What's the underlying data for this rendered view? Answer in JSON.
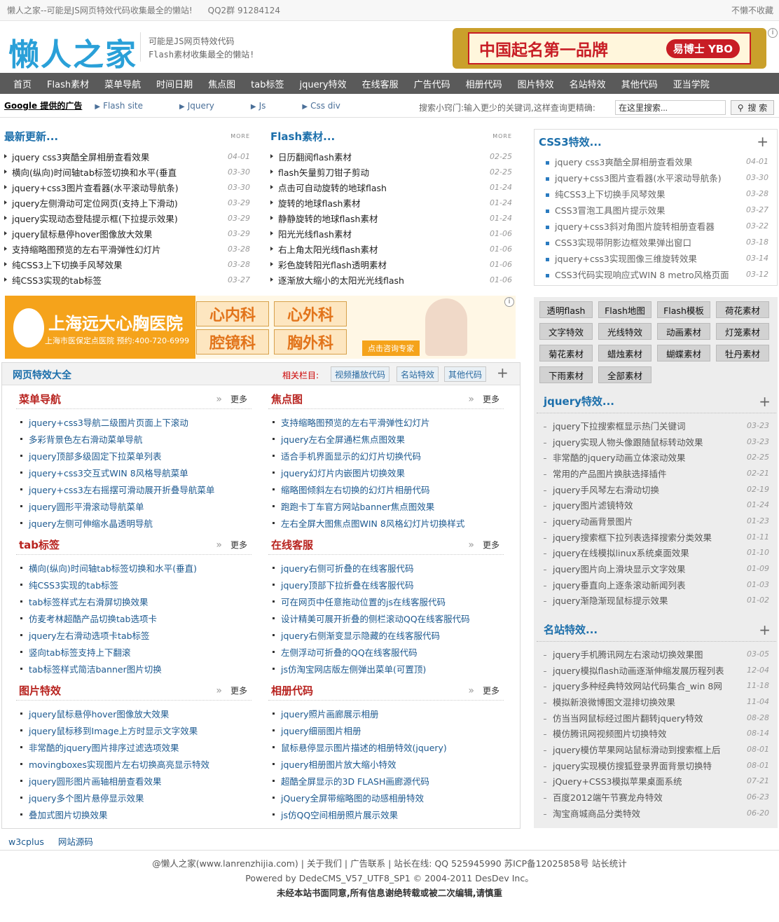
{
  "topbar": {
    "site": "懒人之家--可能是JS网页特效代码收集最全的懒站!",
    "qq": "QQ2群 91284124",
    "right": "不懒不收藏"
  },
  "header": {
    "logo": "懒人之家",
    "slogan1": "可能是JS网页特效代码",
    "slogan2": "Flash素材收集最全的懒站!",
    "ad_text": "中国起名第一品牌",
    "ad_badge": "易博士 YBO"
  },
  "nav": [
    "首页",
    "Flash素材",
    "菜单导航",
    "时间日期",
    "焦点图",
    "tab标签",
    "jquery特效",
    "在线客服",
    "广告代码",
    "相册代码",
    "图片特效",
    "名站特效",
    "其他代码",
    "亚当学院"
  ],
  "subbar": {
    "google": "Google 提供的广告",
    "links": [
      "Flash site",
      "Jquery",
      "Js",
      "Css div"
    ],
    "tip": "搜索小窍门:输入更少的关键词,这样查询更精确:",
    "search_placeholder": "在这里搜索...",
    "search_btn": "搜 索"
  },
  "latest": {
    "title": "最新更新...",
    "more": "MORE",
    "items": [
      {
        "t": "jquery css3爽酷全屏相册查看效果",
        "d": "04-01"
      },
      {
        "t": "横向(纵向)时间轴tab标签切换和水平(垂直",
        "d": "03-30"
      },
      {
        "t": "jquery+css3图片查看器(水平滚动导航条)",
        "d": "03-30"
      },
      {
        "t": "jquery左侧滑动可定位网页(支持上下滑动)",
        "d": "03-29"
      },
      {
        "t": "jquery实现动态登陆提示框(下拉提示效果)",
        "d": "03-29"
      },
      {
        "t": "jquery鼠标悬停hover图像放大效果",
        "d": "03-29"
      },
      {
        "t": "支持缩略图预览的左右平滑弹性幻灯片",
        "d": "03-28"
      },
      {
        "t": "纯CSS3上下切换手风琴效果",
        "d": "03-28"
      },
      {
        "t": "纯CSS3实现的tab标签",
        "d": "03-27"
      }
    ]
  },
  "flash": {
    "title": "Flash素材...",
    "more": "MORE",
    "items": [
      {
        "t": "日历翻阅flash素材",
        "d": "02-25"
      },
      {
        "t": "flash矢量剪刀钳子剪动",
        "d": "02-25"
      },
      {
        "t": "点击可自动旋转的地球flash",
        "d": "01-24"
      },
      {
        "t": "旋转的地球flash素材",
        "d": "01-24"
      },
      {
        "t": "静静旋转的地球flash素材",
        "d": "01-24"
      },
      {
        "t": "阳光光线flash素材",
        "d": "01-06"
      },
      {
        "t": "右上角太阳光线flash素材",
        "d": "01-06"
      },
      {
        "t": "彩色旋转阳光flash透明素材",
        "d": "01-06"
      },
      {
        "t": "逐渐放大缩小的太阳光光线flash",
        "d": "01-06"
      }
    ]
  },
  "css3": {
    "title": "CSS3特效...",
    "items": [
      {
        "t": "jquery css3爽酷全屏相册查看效果",
        "d": "04-01"
      },
      {
        "t": "jquery+css3图片查看器(水平滚动导航条)",
        "d": "03-30"
      },
      {
        "t": "纯CSS3上下切换手风琴效果",
        "d": "03-28"
      },
      {
        "t": "CSS3冒泡工具图片提示效果",
        "d": "03-27"
      },
      {
        "t": "jquery+css3斜对角图片旋转相册查看器",
        "d": "03-22"
      },
      {
        "t": "CSS3实现带阴影边框效果弹出窗口",
        "d": "03-18"
      },
      {
        "t": "jquery+css3实现图像三维旋转效果",
        "d": "03-14"
      },
      {
        "t": "CSS3代码实现响应式WIN 8 metro风格页面",
        "d": "03-12"
      }
    ]
  },
  "ad_mid": {
    "name": "上海远大心胸医院",
    "sub": "上海市医保定点医院  预约:400-720-6999",
    "tiles": [
      "心内科",
      "心外科",
      "腔镜科",
      "胸外科"
    ],
    "cta": "点击咨询专家"
  },
  "main": {
    "title": "网页特效大全",
    "related": "相关栏目:",
    "related_tags": [
      "视频播放代码",
      "名站特效",
      "其他代码"
    ],
    "more": "更多",
    "sections": [
      {
        "title": "菜单导航",
        "items": [
          "jquery+css3导航二级图片页面上下滚动",
          "多彩背景色左右滑动菜单导航",
          "jquery顶部多级固定下拉菜单列表",
          "jquery+css3交互式WIN 8风格导航菜单",
          "jquery+css3左右摇摆可滑动展开折叠导航菜单",
          "jquery圆形平滑滚动导航菜单",
          "jquery左侧可伸缩水晶透明导航"
        ]
      },
      {
        "title": "焦点图",
        "items": [
          "支持缩略图预览的左右平滑弹性幻灯片",
          "jquery左右全屏通栏焦点图效果",
          "适合手机界面显示的幻灯片切换代码",
          "jquery幻灯片内嵌图片切换效果",
          "缩略图倾斜左右切换的幻灯片相册代码",
          "跑跑卡丁车官方网站banner焦点图效果",
          "左右全屏大图焦点图WIN 8风格幻灯片切换样式"
        ]
      },
      {
        "title": "tab标签",
        "items": [
          "横向(纵向)时间轴tab标签切换和水平(垂直)",
          "纯CSS3实现的tab标签",
          "tab标签样式左右滑屏切换效果",
          "仿麦考林超酷产品切换tab选项卡",
          "jquery左右滑动选项卡tab标签",
          "竖向tab标签支持上下翻滚",
          "tab标签样式简洁banner图片切换"
        ]
      },
      {
        "title": "在线客服",
        "items": [
          "jquery右侧可折叠的在线客服代码",
          "jquery顶部下拉折叠在线客服代码",
          "可在网页中任意拖动位置的js在线客服代码",
          "设计精美可展开折叠的侧栏滚动QQ在线客服代码",
          "jquery右侧渐变显示隐藏的在线客服代码",
          "左侧浮动可折叠的QQ在线客服代码",
          "js仿淘宝网店版左侧弹出菜单(可置顶)"
        ]
      },
      {
        "title": "图片特效",
        "items": [
          "jquery鼠标悬停hover图像放大效果",
          "jquery鼠标移到Image上方时显示文字效果",
          "非常酷的jquery图片排序过滤选项效果",
          "movingboxes实现图片左右切换高亮显示特效",
          "jquery圆形图片画轴相册查看效果",
          "jquery多个图片悬停显示效果",
          "叠加式图片切换效果"
        ]
      },
      {
        "title": "相册代码",
        "items": [
          "jquery照片画廊展示相册",
          "jquery细丽图片相册",
          "鼠标悬停显示图片描述的相册特效(jquery)",
          "jquery相册图片放大缩小特效",
          "超酷全屏显示的3D FLASH画廊源代码",
          "jQuery全屏带缩略图的动感相册特效",
          "js仿QQ空间相册照片展示效果"
        ]
      }
    ]
  },
  "tags": [
    "透明flash",
    "Flash地图",
    "Flash模板",
    "荷花素材",
    "文字特效",
    "光线特效",
    "动画素材",
    "灯笼素材",
    "菊花素材",
    "蜡烛素材",
    "蝴蝶素材",
    "牡丹素材",
    "下雨素材",
    "全部素材"
  ],
  "jquery": {
    "title": "jquery特效...",
    "items": [
      {
        "t": "jquery下拉搜索框显示热门关键词",
        "d": "03-23"
      },
      {
        "t": "jquery实现人物头像跟随鼠标转动效果",
        "d": "03-23"
      },
      {
        "t": "非常酷的jquery动画立体滚动效果",
        "d": "02-25"
      },
      {
        "t": "常用的产品图片换肤选择插件",
        "d": "02-21"
      },
      {
        "t": "jquery手风琴左右滑动切换",
        "d": "02-19"
      },
      {
        "t": "jquery图片滤镜特效",
        "d": "01-24"
      },
      {
        "t": "jquery动画背景图片",
        "d": "01-23"
      },
      {
        "t": "jquery搜索框下拉列表选择搜索分类效果",
        "d": "01-11"
      },
      {
        "t": "jquery在线模拟linux系统桌面效果",
        "d": "01-10"
      },
      {
        "t": "jquery图片向上滑块显示文字效果",
        "d": "01-09"
      },
      {
        "t": "jquery垂直向上逐条滚动新闻列表",
        "d": "01-03"
      },
      {
        "t": "jquery渐隐渐现鼠标提示效果",
        "d": "01-02"
      }
    ]
  },
  "famous": {
    "title": "名站特效...",
    "items": [
      {
        "t": "jquery手机腾讯网左右滚动切换效果图",
        "d": "03-05"
      },
      {
        "t": "jquery模拟flash动画逐渐伸缩发展历程列表",
        "d": "12-04"
      },
      {
        "t": "jquery多种经典特效网站代码集合_win 8网",
        "d": "11-18"
      },
      {
        "t": "模拟新浪微博图文混排切换效果",
        "d": "11-04"
      },
      {
        "t": "仿当当网鼠标经过图片翻转jquery特效",
        "d": "08-28"
      },
      {
        "t": "模仿腾讯网视频图片切换特效",
        "d": "08-14"
      },
      {
        "t": "jquery模仿苹果网站鼠标滑动到搜索框上后",
        "d": "08-01"
      },
      {
        "t": "jquery实现模仿搜狐登录界面背景切换特",
        "d": "08-01"
      },
      {
        "t": "jQuery+CSS3模拟苹果桌面系统",
        "d": "07-21"
      },
      {
        "t": "百度2012端午节赛龙舟特效",
        "d": "06-23"
      },
      {
        "t": "淘宝商城商品分类特效",
        "d": "06-20"
      }
    ]
  },
  "links": [
    "w3cplus",
    "网站源码"
  ],
  "footer": {
    "l1": "@懒人之家(www.lanrenzhijia.com) | 关于我们 | 广告联系 | 站长在线: QQ 525945990  苏ICP备12025858号  站长统计",
    "l2": "Powered by DedeCMS_V57_UTF8_SP1 © 2004-2011 DesDev Inc。",
    "l3": "未经本站书面同意,所有信息谢绝转载或被二次编辑,请慎重"
  }
}
